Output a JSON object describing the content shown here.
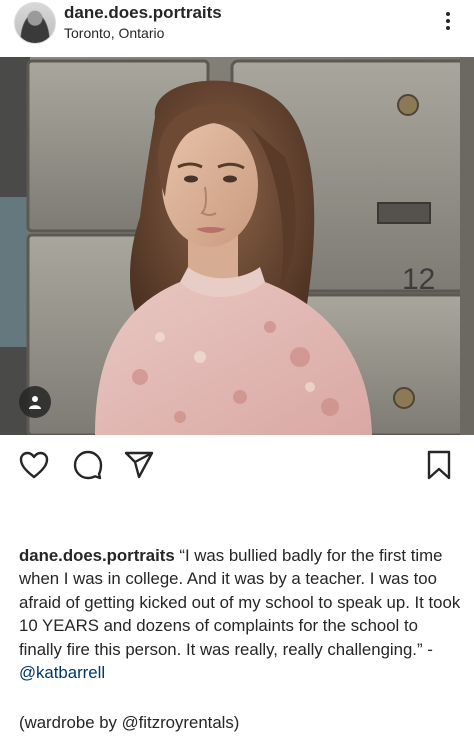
{
  "post": {
    "username": "dane.does.portraits",
    "location": "Toronto, Ontario"
  },
  "icons": {
    "more": "more-vertical-icon",
    "user_tag": "user-tag-icon",
    "like": "heart-icon",
    "comment": "comment-icon",
    "share": "send-icon",
    "save": "bookmark-icon"
  },
  "caption": {
    "username": "dane.does.portraits",
    "text": " “I was bullied badly for the first time when I was in college. And it was by a teacher. I was too afraid of getting kicked out of my school to speak up. It took 10 YEARS and dozens of complaints for the school to finally fire this person. It was really, really challenging.” - ",
    "mention": "@katbarrell"
  },
  "credit": {
    "prefix": "(wardrobe by ",
    "mention": "@fitzroyrentals",
    "suffix": ")"
  },
  "colors": {
    "text": "#262626",
    "mention": "#00376b",
    "background": "#ffffff"
  }
}
